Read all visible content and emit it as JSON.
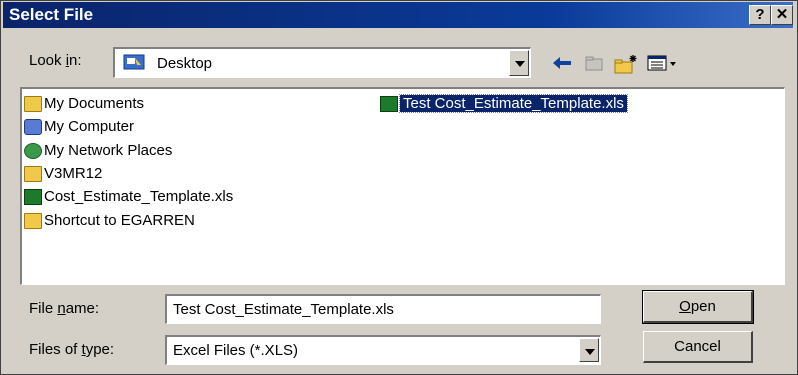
{
  "window": {
    "title": "Select File",
    "help_glyph": "?",
    "close_glyph": "✕"
  },
  "look_in": {
    "label": "Look in:",
    "value": "Desktop"
  },
  "toolbar": {
    "back_icon": "back-arrow-icon",
    "up_icon": "up-folder-icon",
    "new_folder_icon": "new-folder-icon",
    "view_icon": "view-menu-icon"
  },
  "files": [
    {
      "label": "My Documents",
      "icon": "folder-icon"
    },
    {
      "label": "My Computer",
      "icon": "computer-icon"
    },
    {
      "label": "My Network Places",
      "icon": "network-icon"
    },
    {
      "label": "V3MR12",
      "icon": "folder-icon"
    },
    {
      "label": "Cost_Estimate_Template.xls",
      "icon": "excel-file-icon"
    },
    {
      "label": "Shortcut to EGARREN",
      "icon": "folder-shortcut-icon"
    },
    {
      "label": "Test Cost_Estimate_Template.xls",
      "icon": "excel-file-icon",
      "selected": true
    }
  ],
  "file_name": {
    "label_pre": "File ",
    "label_u": "n",
    "label_post": "ame:",
    "value": "Test Cost_Estimate_Template.xls"
  },
  "file_type": {
    "label_pre": "Files of ",
    "label_u": "t",
    "label_post": "ype:",
    "value": "Excel Files (*.XLS)"
  },
  "buttons": {
    "open_u": "O",
    "open_rest": "pen",
    "cancel": "Cancel"
  },
  "colors": {
    "titlebar": "#0a246a",
    "dialog_bg": "#d4d0c8",
    "selection": "#0a246a"
  }
}
